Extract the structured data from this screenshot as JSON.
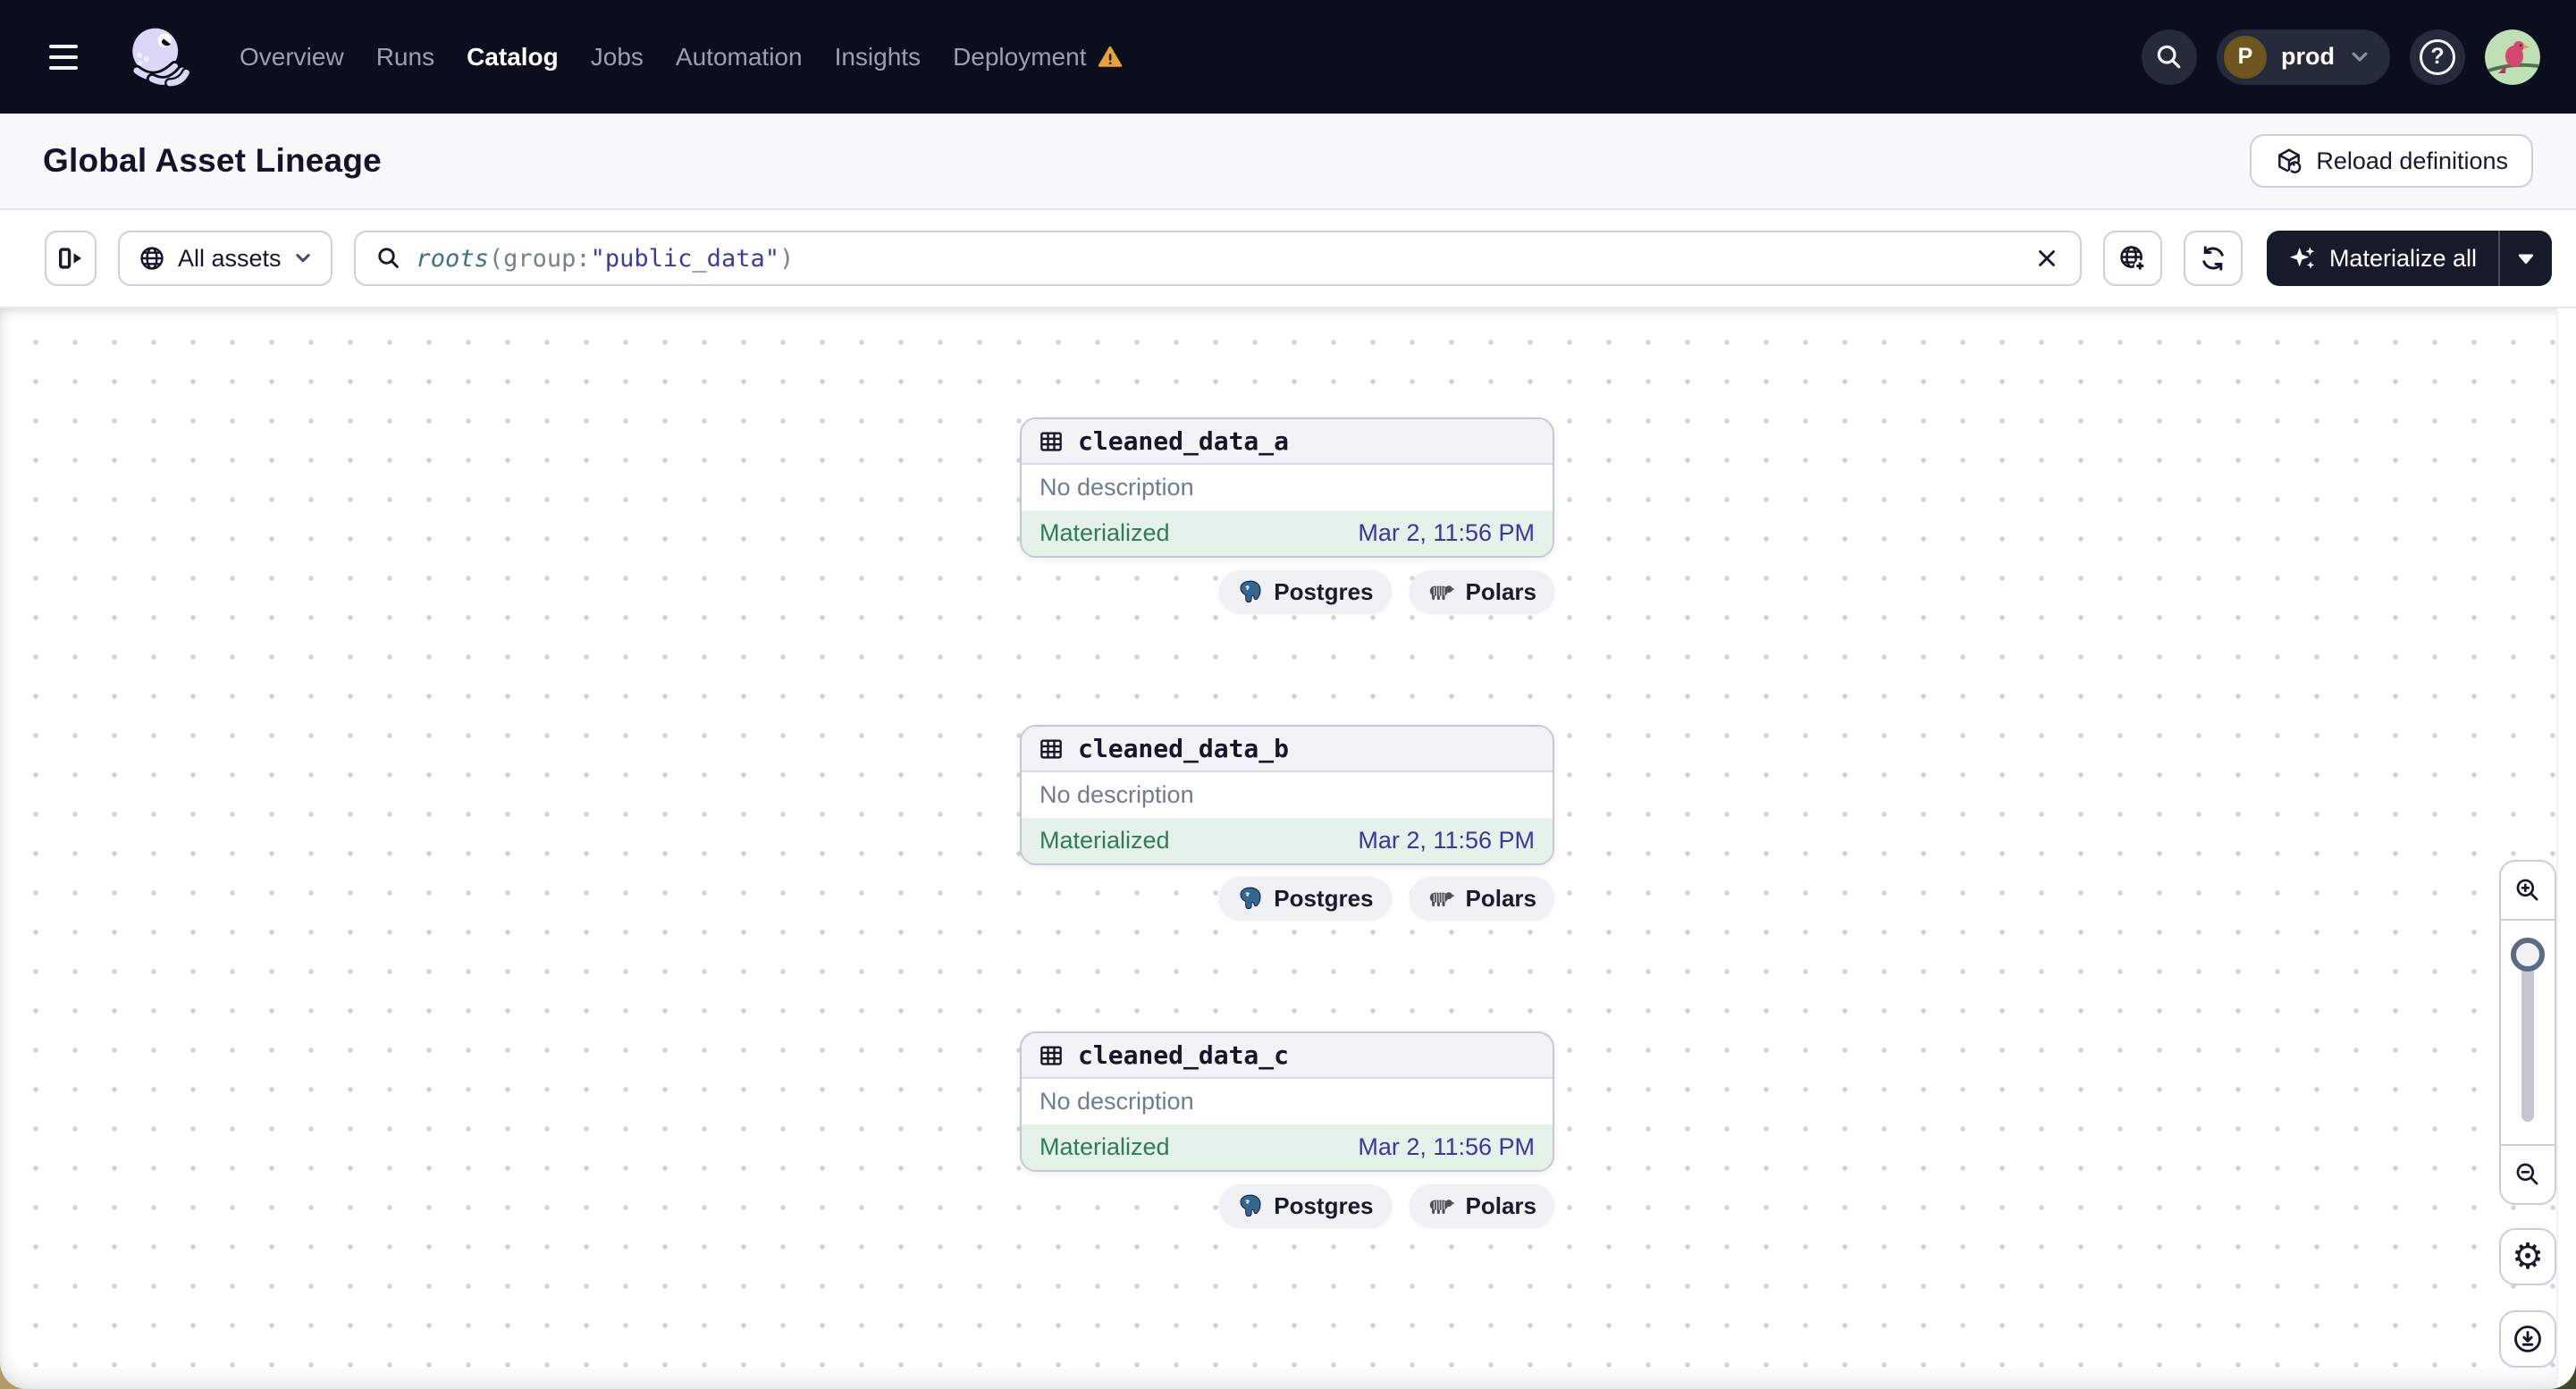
{
  "navbar": {
    "items": [
      {
        "label": "Overview"
      },
      {
        "label": "Runs"
      },
      {
        "label": "Catalog",
        "active": true
      },
      {
        "label": "Jobs"
      },
      {
        "label": "Automation"
      },
      {
        "label": "Insights"
      },
      {
        "label": "Deployment",
        "warning": true
      }
    ],
    "environment": {
      "initial": "P",
      "name": "prod"
    }
  },
  "header": {
    "title": "Global Asset Lineage",
    "reload_button": "Reload definitions"
  },
  "toolbar": {
    "filter": {
      "label": "All assets"
    },
    "search": {
      "fn": "roots",
      "paren_open": "(",
      "key": "group",
      "colon": ":",
      "value": "\"public_data\"",
      "paren_close": ")"
    },
    "materialize": {
      "label": "Materialize all"
    }
  },
  "graph": {
    "assets": [
      {
        "name": "cleaned_data_a",
        "description": "No description",
        "status": "Materialized",
        "timestamp": "Mar 2, 11:56 PM",
        "tags": [
          "Postgres",
          "Polars"
        ]
      },
      {
        "name": "cleaned_data_b",
        "description": "No description",
        "status": "Materialized",
        "timestamp": "Mar 2, 11:56 PM",
        "tags": [
          "Postgres",
          "Polars"
        ]
      },
      {
        "name": "cleaned_data_c",
        "description": "No description",
        "status": "Materialized",
        "timestamp": "Mar 2, 11:56 PM",
        "tags": [
          "Postgres",
          "Polars"
        ]
      }
    ]
  },
  "icons": {
    "menu": "hamburger",
    "logo": "dagster-octopus",
    "warning": "warning-triangle",
    "search": "magnifier",
    "help": "question-circle",
    "reload": "cube-refresh",
    "panel": "panel-expand",
    "globe": "globe",
    "chevron": "chevron-down",
    "clear": "x",
    "globe_add": "globe-plus",
    "refresh": "sync-arrows",
    "sparkle": "sparkles",
    "caret": "caret-down",
    "table": "table-grid",
    "postgres": "postgres-elephant",
    "polars": "polar-bear",
    "zoom_in": "magnifier-plus",
    "zoom_out": "magnifier-minus",
    "settings": "gear",
    "download": "download-circle"
  },
  "colors": {
    "navbar_bg": "#0b0e1c",
    "logo_lavender": "#d9d8f6",
    "warning_orange": "#e9a23b",
    "status_green": "#2f7c54",
    "materialized_bg": "#e4f2e9",
    "timestamp_indigo": "#3a37a0",
    "query_fn_teal": "#3c7089",
    "query_value_indigo": "#3a3aa0",
    "dark_button_bg": "#161a29",
    "tag_bg": "#f0f1f4",
    "grid_dot": "#d2d4dd"
  }
}
